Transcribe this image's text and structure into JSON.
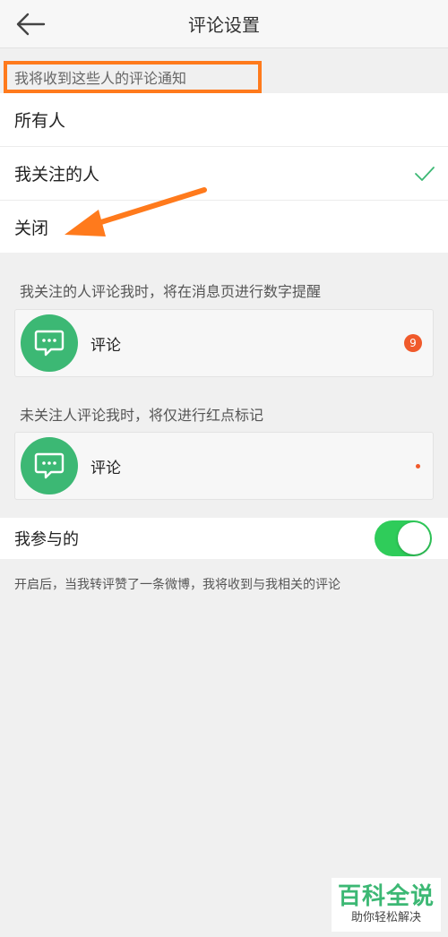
{
  "header": {
    "title": "评论设置"
  },
  "notify_section": {
    "title": "我将收到这些人的评论通知",
    "options": [
      {
        "label": "所有人",
        "selected": false
      },
      {
        "label": "我关注的人",
        "selected": true
      },
      {
        "label": "关闭",
        "selected": false
      }
    ]
  },
  "followed": {
    "desc": "我关注的人评论我时，将在消息页进行数字提醒",
    "card_label": "评论",
    "badge": "9"
  },
  "unfollowed": {
    "desc": "未关注人评论我时，将仅进行红点标记",
    "card_label": "评论"
  },
  "participate": {
    "label": "我参与的",
    "enabled": true,
    "desc": "开启后，当我转评赞了一条微博，我将收到与我相关的评论"
  },
  "watermark": {
    "main": "百科全说",
    "sub": "助你轻松解决"
  },
  "colors": {
    "accent": "#3cb874",
    "highlight": "#ff7a1c",
    "toggle_on": "#2fcc5a",
    "badge": "#f05a2b"
  }
}
